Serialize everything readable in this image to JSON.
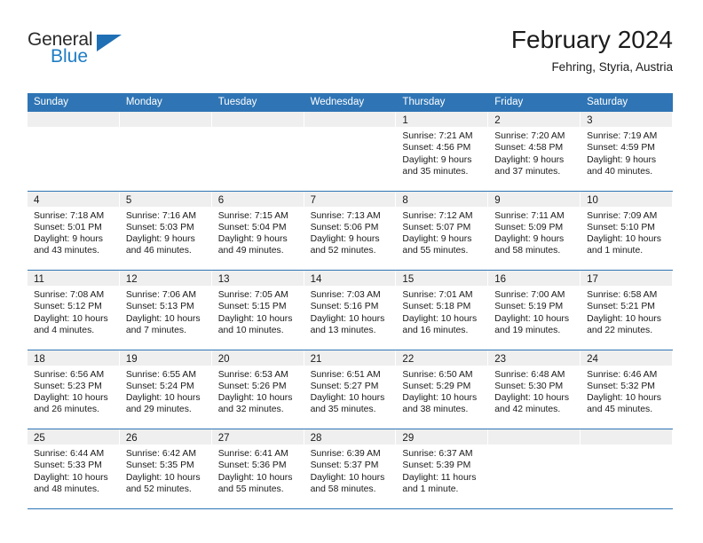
{
  "logo": {
    "line1": "General",
    "line2": "Blue",
    "icon": "triangle-icon"
  },
  "header": {
    "title": "February 2024",
    "subtitle": "Fehring, Styria, Austria"
  },
  "colors": {
    "header_blue": "#2f75b5",
    "daynum_strip": "#efefef",
    "logo_blue": "#1f7dc4",
    "text": "#1a1a1a"
  },
  "weekdays": [
    "Sunday",
    "Monday",
    "Tuesday",
    "Wednesday",
    "Thursday",
    "Friday",
    "Saturday"
  ],
  "weeks": [
    [
      {
        "empty": true
      },
      {
        "empty": true
      },
      {
        "empty": true
      },
      {
        "empty": true
      },
      {
        "day": "1",
        "sunrise": "Sunrise: 7:21 AM",
        "sunset": "Sunset: 4:56 PM",
        "daylight1": "Daylight: 9 hours",
        "daylight2": "and 35 minutes."
      },
      {
        "day": "2",
        "sunrise": "Sunrise: 7:20 AM",
        "sunset": "Sunset: 4:58 PM",
        "daylight1": "Daylight: 9 hours",
        "daylight2": "and 37 minutes."
      },
      {
        "day": "3",
        "sunrise": "Sunrise: 7:19 AM",
        "sunset": "Sunset: 4:59 PM",
        "daylight1": "Daylight: 9 hours",
        "daylight2": "and 40 minutes."
      }
    ],
    [
      {
        "day": "4",
        "sunrise": "Sunrise: 7:18 AM",
        "sunset": "Sunset: 5:01 PM",
        "daylight1": "Daylight: 9 hours",
        "daylight2": "and 43 minutes."
      },
      {
        "day": "5",
        "sunrise": "Sunrise: 7:16 AM",
        "sunset": "Sunset: 5:03 PM",
        "daylight1": "Daylight: 9 hours",
        "daylight2": "and 46 minutes."
      },
      {
        "day": "6",
        "sunrise": "Sunrise: 7:15 AM",
        "sunset": "Sunset: 5:04 PM",
        "daylight1": "Daylight: 9 hours",
        "daylight2": "and 49 minutes."
      },
      {
        "day": "7",
        "sunrise": "Sunrise: 7:13 AM",
        "sunset": "Sunset: 5:06 PM",
        "daylight1": "Daylight: 9 hours",
        "daylight2": "and 52 minutes."
      },
      {
        "day": "8",
        "sunrise": "Sunrise: 7:12 AM",
        "sunset": "Sunset: 5:07 PM",
        "daylight1": "Daylight: 9 hours",
        "daylight2": "and 55 minutes."
      },
      {
        "day": "9",
        "sunrise": "Sunrise: 7:11 AM",
        "sunset": "Sunset: 5:09 PM",
        "daylight1": "Daylight: 9 hours",
        "daylight2": "and 58 minutes."
      },
      {
        "day": "10",
        "sunrise": "Sunrise: 7:09 AM",
        "sunset": "Sunset: 5:10 PM",
        "daylight1": "Daylight: 10 hours",
        "daylight2": "and 1 minute."
      }
    ],
    [
      {
        "day": "11",
        "sunrise": "Sunrise: 7:08 AM",
        "sunset": "Sunset: 5:12 PM",
        "daylight1": "Daylight: 10 hours",
        "daylight2": "and 4 minutes."
      },
      {
        "day": "12",
        "sunrise": "Sunrise: 7:06 AM",
        "sunset": "Sunset: 5:13 PM",
        "daylight1": "Daylight: 10 hours",
        "daylight2": "and 7 minutes."
      },
      {
        "day": "13",
        "sunrise": "Sunrise: 7:05 AM",
        "sunset": "Sunset: 5:15 PM",
        "daylight1": "Daylight: 10 hours",
        "daylight2": "and 10 minutes."
      },
      {
        "day": "14",
        "sunrise": "Sunrise: 7:03 AM",
        "sunset": "Sunset: 5:16 PM",
        "daylight1": "Daylight: 10 hours",
        "daylight2": "and 13 minutes."
      },
      {
        "day": "15",
        "sunrise": "Sunrise: 7:01 AM",
        "sunset": "Sunset: 5:18 PM",
        "daylight1": "Daylight: 10 hours",
        "daylight2": "and 16 minutes."
      },
      {
        "day": "16",
        "sunrise": "Sunrise: 7:00 AM",
        "sunset": "Sunset: 5:19 PM",
        "daylight1": "Daylight: 10 hours",
        "daylight2": "and 19 minutes."
      },
      {
        "day": "17",
        "sunrise": "Sunrise: 6:58 AM",
        "sunset": "Sunset: 5:21 PM",
        "daylight1": "Daylight: 10 hours",
        "daylight2": "and 22 minutes."
      }
    ],
    [
      {
        "day": "18",
        "sunrise": "Sunrise: 6:56 AM",
        "sunset": "Sunset: 5:23 PM",
        "daylight1": "Daylight: 10 hours",
        "daylight2": "and 26 minutes."
      },
      {
        "day": "19",
        "sunrise": "Sunrise: 6:55 AM",
        "sunset": "Sunset: 5:24 PM",
        "daylight1": "Daylight: 10 hours",
        "daylight2": "and 29 minutes."
      },
      {
        "day": "20",
        "sunrise": "Sunrise: 6:53 AM",
        "sunset": "Sunset: 5:26 PM",
        "daylight1": "Daylight: 10 hours",
        "daylight2": "and 32 minutes."
      },
      {
        "day": "21",
        "sunrise": "Sunrise: 6:51 AM",
        "sunset": "Sunset: 5:27 PM",
        "daylight1": "Daylight: 10 hours",
        "daylight2": "and 35 minutes."
      },
      {
        "day": "22",
        "sunrise": "Sunrise: 6:50 AM",
        "sunset": "Sunset: 5:29 PM",
        "daylight1": "Daylight: 10 hours",
        "daylight2": "and 38 minutes."
      },
      {
        "day": "23",
        "sunrise": "Sunrise: 6:48 AM",
        "sunset": "Sunset: 5:30 PM",
        "daylight1": "Daylight: 10 hours",
        "daylight2": "and 42 minutes."
      },
      {
        "day": "24",
        "sunrise": "Sunrise: 6:46 AM",
        "sunset": "Sunset: 5:32 PM",
        "daylight1": "Daylight: 10 hours",
        "daylight2": "and 45 minutes."
      }
    ],
    [
      {
        "day": "25",
        "sunrise": "Sunrise: 6:44 AM",
        "sunset": "Sunset: 5:33 PM",
        "daylight1": "Daylight: 10 hours",
        "daylight2": "and 48 minutes."
      },
      {
        "day": "26",
        "sunrise": "Sunrise: 6:42 AM",
        "sunset": "Sunset: 5:35 PM",
        "daylight1": "Daylight: 10 hours",
        "daylight2": "and 52 minutes."
      },
      {
        "day": "27",
        "sunrise": "Sunrise: 6:41 AM",
        "sunset": "Sunset: 5:36 PM",
        "daylight1": "Daylight: 10 hours",
        "daylight2": "and 55 minutes."
      },
      {
        "day": "28",
        "sunrise": "Sunrise: 6:39 AM",
        "sunset": "Sunset: 5:37 PM",
        "daylight1": "Daylight: 10 hours",
        "daylight2": "and 58 minutes."
      },
      {
        "day": "29",
        "sunrise": "Sunrise: 6:37 AM",
        "sunset": "Sunset: 5:39 PM",
        "daylight1": "Daylight: 11 hours",
        "daylight2": "and 1 minute."
      },
      {
        "empty": true
      },
      {
        "empty": true
      }
    ]
  ]
}
